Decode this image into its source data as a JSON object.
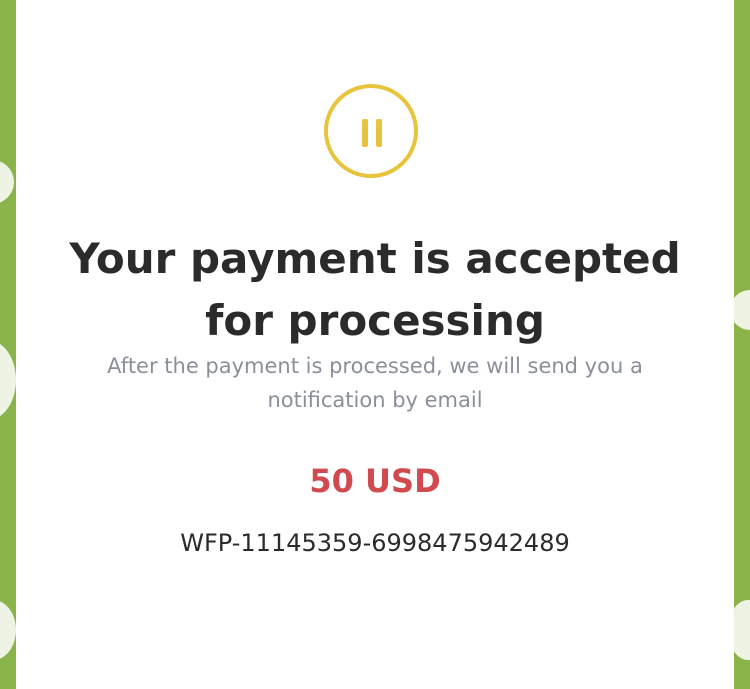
{
  "colors": {
    "background_green": "#8ab34a",
    "card": "#ffffff",
    "status_icon": "#e8c43c",
    "title": "#2b2b2b",
    "subtitle": "#8a8f99",
    "amount": "#d04a4f"
  },
  "status": {
    "icon": "pause-icon",
    "title": "Your payment is accepted for processing",
    "message": "After the payment is processed, we will send you a notification by email"
  },
  "payment": {
    "amount": "50 USD",
    "order_id": "WFP-11145359-6998475942489"
  }
}
